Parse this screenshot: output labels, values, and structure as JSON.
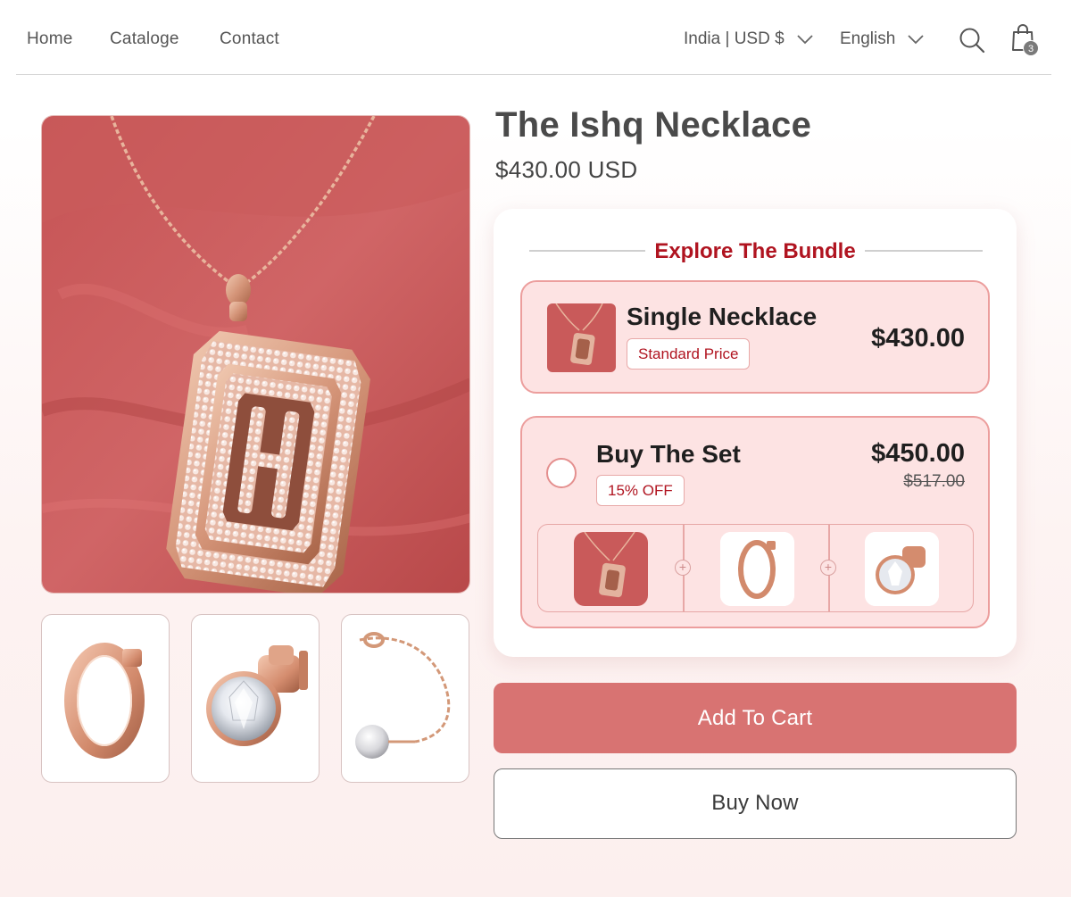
{
  "nav": {
    "links": [
      "Home",
      "Cataloge",
      "Contact"
    ],
    "region_selector": "India | USD $",
    "language_selector": "English",
    "cart_count": "3"
  },
  "icons": [
    "chevron-down-icon",
    "search-icon",
    "shopping-bag-icon",
    "plus-icon"
  ],
  "product": {
    "title": "The Ishq Necklace",
    "price": "$430.00 USD"
  },
  "bundle": {
    "heading": "Explore The Bundle",
    "single": {
      "name": "Single Necklace",
      "badge": "Standard Price",
      "price": "$430.00"
    },
    "set": {
      "name": "Buy The Set",
      "badge": "15% OFF",
      "price": "$450.00",
      "old_price": "$517.00"
    }
  },
  "buttons": {
    "add_to_cart": "Add To Cart",
    "buy_now": "Buy Now"
  },
  "colors": {
    "accent": "#d87372",
    "brand_red": "#b01420",
    "option_bg": "#fde3e3",
    "option_border": "#ec9e9d",
    "product_backdrop": "#c95a5a",
    "rose_gold": "#d59a7f"
  }
}
